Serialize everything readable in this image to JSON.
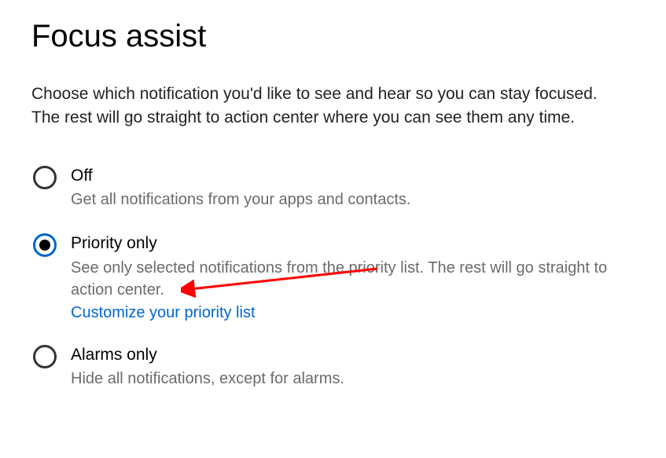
{
  "page": {
    "title": "Focus assist",
    "description": "Choose which notification you'd like to see and hear so you can stay focused. The rest will go straight to action center where you can see them any time."
  },
  "options": {
    "off": {
      "label": "Off",
      "desc": "Get all notifications from your apps and contacts.",
      "selected": false
    },
    "priority": {
      "label": "Priority only",
      "desc": "See only selected notifications from the priority list. The rest will go straight to action center.",
      "link": "Customize your priority list",
      "selected": true
    },
    "alarms": {
      "label": "Alarms only",
      "desc": "Hide all notifications, except for alarms.",
      "selected": false
    }
  },
  "colors": {
    "accent": "#0066cc",
    "annotation": "#ff0000"
  }
}
